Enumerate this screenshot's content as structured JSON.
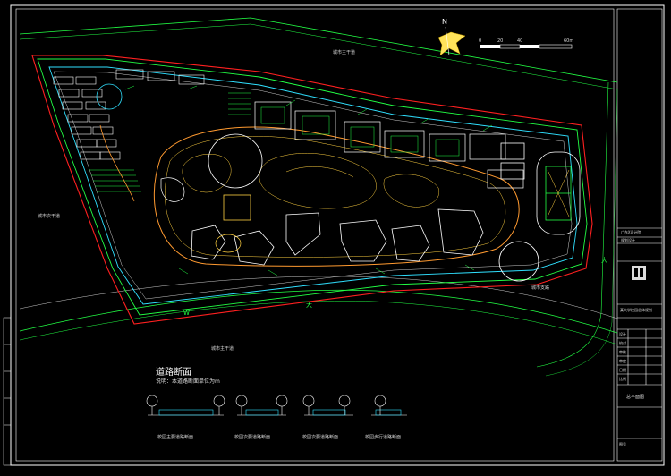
{
  "drawing": {
    "section_title": "道路断面",
    "section_note": "说明：本道路断面单位为m",
    "north_label": "N",
    "scale_ticks": [
      "0",
      "20",
      "40",
      "60m"
    ],
    "road_labels": {
      "top": "城市主干道",
      "left": "城市次干道",
      "bottom": "城市主干道",
      "right": "城市支路"
    },
    "section_captions": [
      "校园主要道路断面",
      "校园次要道路断面",
      "校园次要道路断面",
      "校园步行道路断面"
    ],
    "markers": [
      "W",
      "大",
      "大"
    ]
  },
  "title_block": {
    "firm_line1": "广东X设计院",
    "firm_line2": "规划设计",
    "project": "某大学校园总体规划",
    "drawing_name": "总平面图",
    "rows": [
      "设计",
      "校对",
      "审核",
      "审定",
      "日期",
      "比例",
      "图号"
    ]
  },
  "colors": {
    "background": "#000000",
    "red_line": "#ff2020",
    "green_line": "#22ff44",
    "cyan_line": "#30e0ff",
    "yellow_line": "#ffd040",
    "white_line": "#ffffff",
    "orange_line": "#ff9a30"
  }
}
